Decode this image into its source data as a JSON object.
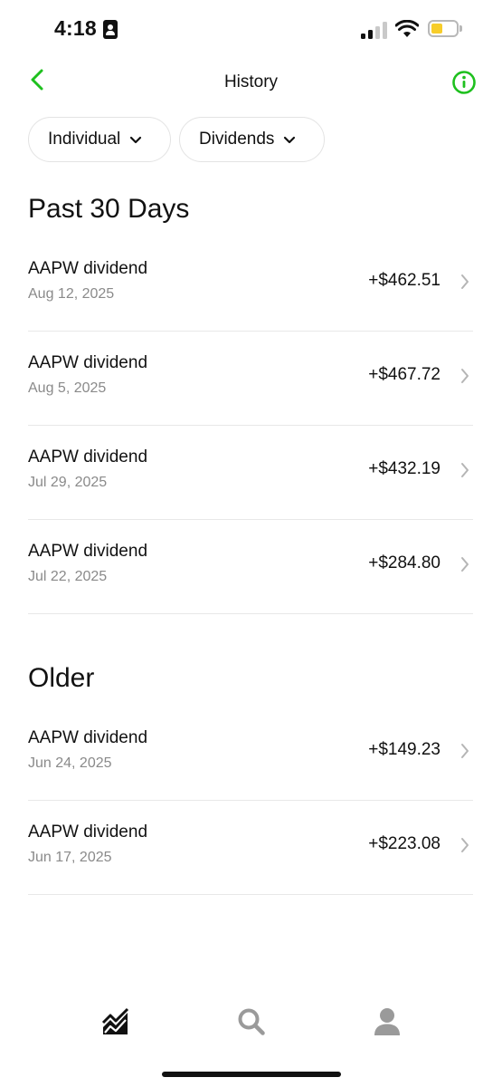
{
  "status_bar": {
    "time": "4:18"
  },
  "header": {
    "title": "History"
  },
  "filters": [
    {
      "label": "Individual"
    },
    {
      "label": "Dividends"
    }
  ],
  "sections": [
    {
      "heading": "Past 30 Days",
      "rows": [
        {
          "title": "AAPW dividend",
          "date": "Aug 12, 2025",
          "amount": "+$462.51"
        },
        {
          "title": "AAPW dividend",
          "date": "Aug 5, 2025",
          "amount": "+$467.72"
        },
        {
          "title": "AAPW dividend",
          "date": "Jul 29, 2025",
          "amount": "+$432.19"
        },
        {
          "title": "AAPW dividend",
          "date": "Jul 22, 2025",
          "amount": "+$284.80"
        }
      ]
    },
    {
      "heading": "Older",
      "rows": [
        {
          "title": "AAPW dividend",
          "date": "Jun 24, 2025",
          "amount": "+$149.23"
        },
        {
          "title": "AAPW dividend",
          "date": "Jun 17, 2025",
          "amount": "+$223.08"
        }
      ]
    }
  ],
  "tab_bar": {
    "tabs": [
      {
        "icon": "chart-icon",
        "active": true
      },
      {
        "icon": "search-icon",
        "active": false
      },
      {
        "icon": "profile-icon",
        "active": false
      }
    ]
  },
  "colors": {
    "accent": "#1ec01e",
    "text": "#111111",
    "secondary_text": "#8a8a8a",
    "divider": "#e8e8e8",
    "battery": "#f7cd2a"
  }
}
